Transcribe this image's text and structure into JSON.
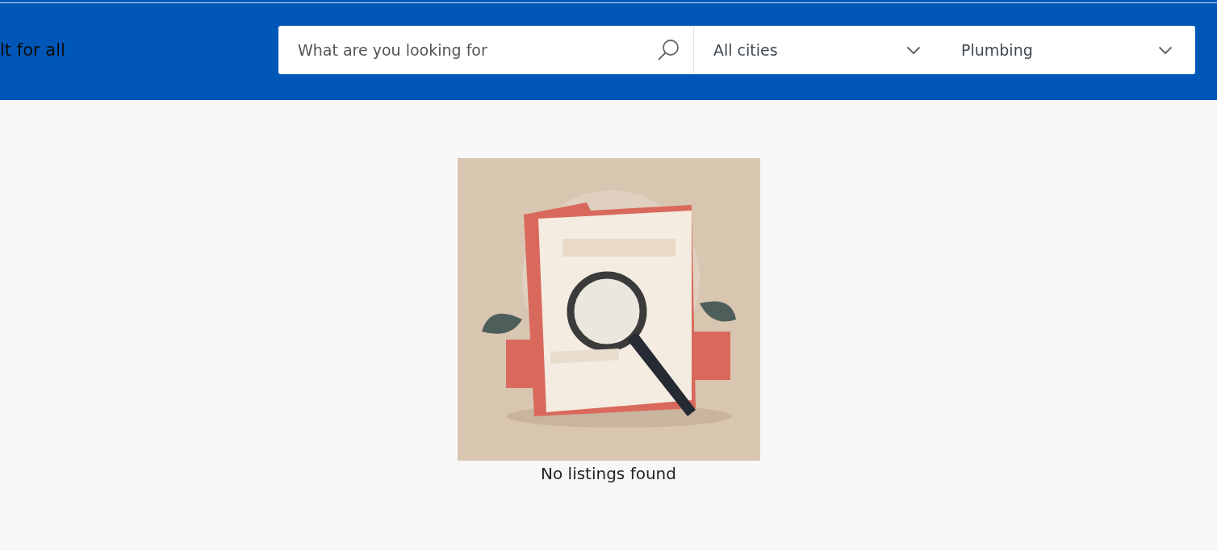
{
  "header": {
    "title": "lt for all"
  },
  "search": {
    "placeholder": "What are you looking for"
  },
  "filters": [
    {
      "kind": "dropdown",
      "value": "All cities"
    },
    {
      "kind": "dropdown",
      "value": "Plumbing"
    }
  ],
  "results": {
    "message": "No listings found"
  }
}
